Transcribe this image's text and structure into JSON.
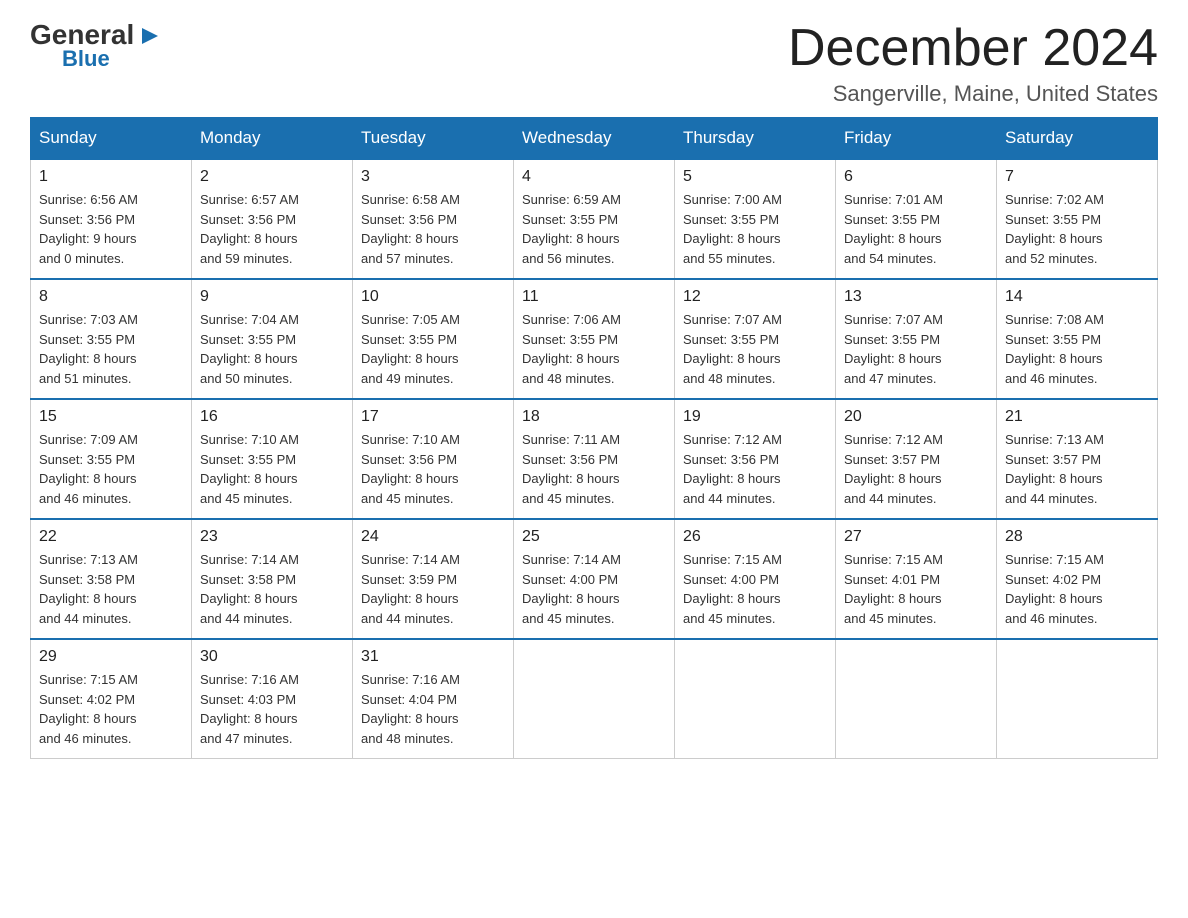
{
  "logo": {
    "general": "General",
    "blue": "Blue",
    "arrow": "▶"
  },
  "title": "December 2024",
  "location": "Sangerville, Maine, United States",
  "days_of_week": [
    "Sunday",
    "Monday",
    "Tuesday",
    "Wednesday",
    "Thursday",
    "Friday",
    "Saturday"
  ],
  "weeks": [
    [
      {
        "day": "1",
        "sunrise": "6:56 AM",
        "sunset": "3:56 PM",
        "daylight": "9 hours and 0 minutes."
      },
      {
        "day": "2",
        "sunrise": "6:57 AM",
        "sunset": "3:56 PM",
        "daylight": "8 hours and 59 minutes."
      },
      {
        "day": "3",
        "sunrise": "6:58 AM",
        "sunset": "3:56 PM",
        "daylight": "8 hours and 57 minutes."
      },
      {
        "day": "4",
        "sunrise": "6:59 AM",
        "sunset": "3:55 PM",
        "daylight": "8 hours and 56 minutes."
      },
      {
        "day": "5",
        "sunrise": "7:00 AM",
        "sunset": "3:55 PM",
        "daylight": "8 hours and 55 minutes."
      },
      {
        "day": "6",
        "sunrise": "7:01 AM",
        "sunset": "3:55 PM",
        "daylight": "8 hours and 54 minutes."
      },
      {
        "day": "7",
        "sunrise": "7:02 AM",
        "sunset": "3:55 PM",
        "daylight": "8 hours and 52 minutes."
      }
    ],
    [
      {
        "day": "8",
        "sunrise": "7:03 AM",
        "sunset": "3:55 PM",
        "daylight": "8 hours and 51 minutes."
      },
      {
        "day": "9",
        "sunrise": "7:04 AM",
        "sunset": "3:55 PM",
        "daylight": "8 hours and 50 minutes."
      },
      {
        "day": "10",
        "sunrise": "7:05 AM",
        "sunset": "3:55 PM",
        "daylight": "8 hours and 49 minutes."
      },
      {
        "day": "11",
        "sunrise": "7:06 AM",
        "sunset": "3:55 PM",
        "daylight": "8 hours and 48 minutes."
      },
      {
        "day": "12",
        "sunrise": "7:07 AM",
        "sunset": "3:55 PM",
        "daylight": "8 hours and 48 minutes."
      },
      {
        "day": "13",
        "sunrise": "7:07 AM",
        "sunset": "3:55 PM",
        "daylight": "8 hours and 47 minutes."
      },
      {
        "day": "14",
        "sunrise": "7:08 AM",
        "sunset": "3:55 PM",
        "daylight": "8 hours and 46 minutes."
      }
    ],
    [
      {
        "day": "15",
        "sunrise": "7:09 AM",
        "sunset": "3:55 PM",
        "daylight": "8 hours and 46 minutes."
      },
      {
        "day": "16",
        "sunrise": "7:10 AM",
        "sunset": "3:55 PM",
        "daylight": "8 hours and 45 minutes."
      },
      {
        "day": "17",
        "sunrise": "7:10 AM",
        "sunset": "3:56 PM",
        "daylight": "8 hours and 45 minutes."
      },
      {
        "day": "18",
        "sunrise": "7:11 AM",
        "sunset": "3:56 PM",
        "daylight": "8 hours and 45 minutes."
      },
      {
        "day": "19",
        "sunrise": "7:12 AM",
        "sunset": "3:56 PM",
        "daylight": "8 hours and 44 minutes."
      },
      {
        "day": "20",
        "sunrise": "7:12 AM",
        "sunset": "3:57 PM",
        "daylight": "8 hours and 44 minutes."
      },
      {
        "day": "21",
        "sunrise": "7:13 AM",
        "sunset": "3:57 PM",
        "daylight": "8 hours and 44 minutes."
      }
    ],
    [
      {
        "day": "22",
        "sunrise": "7:13 AM",
        "sunset": "3:58 PM",
        "daylight": "8 hours and 44 minutes."
      },
      {
        "day": "23",
        "sunrise": "7:14 AM",
        "sunset": "3:58 PM",
        "daylight": "8 hours and 44 minutes."
      },
      {
        "day": "24",
        "sunrise": "7:14 AM",
        "sunset": "3:59 PM",
        "daylight": "8 hours and 44 minutes."
      },
      {
        "day": "25",
        "sunrise": "7:14 AM",
        "sunset": "4:00 PM",
        "daylight": "8 hours and 45 minutes."
      },
      {
        "day": "26",
        "sunrise": "7:15 AM",
        "sunset": "4:00 PM",
        "daylight": "8 hours and 45 minutes."
      },
      {
        "day": "27",
        "sunrise": "7:15 AM",
        "sunset": "4:01 PM",
        "daylight": "8 hours and 45 minutes."
      },
      {
        "day": "28",
        "sunrise": "7:15 AM",
        "sunset": "4:02 PM",
        "daylight": "8 hours and 46 minutes."
      }
    ],
    [
      {
        "day": "29",
        "sunrise": "7:15 AM",
        "sunset": "4:02 PM",
        "daylight": "8 hours and 46 minutes."
      },
      {
        "day": "30",
        "sunrise": "7:16 AM",
        "sunset": "4:03 PM",
        "daylight": "8 hours and 47 minutes."
      },
      {
        "day": "31",
        "sunrise": "7:16 AM",
        "sunset": "4:04 PM",
        "daylight": "8 hours and 48 minutes."
      },
      null,
      null,
      null,
      null
    ]
  ],
  "labels": {
    "sunrise": "Sunrise:",
    "sunset": "Sunset:",
    "daylight": "Daylight:"
  }
}
